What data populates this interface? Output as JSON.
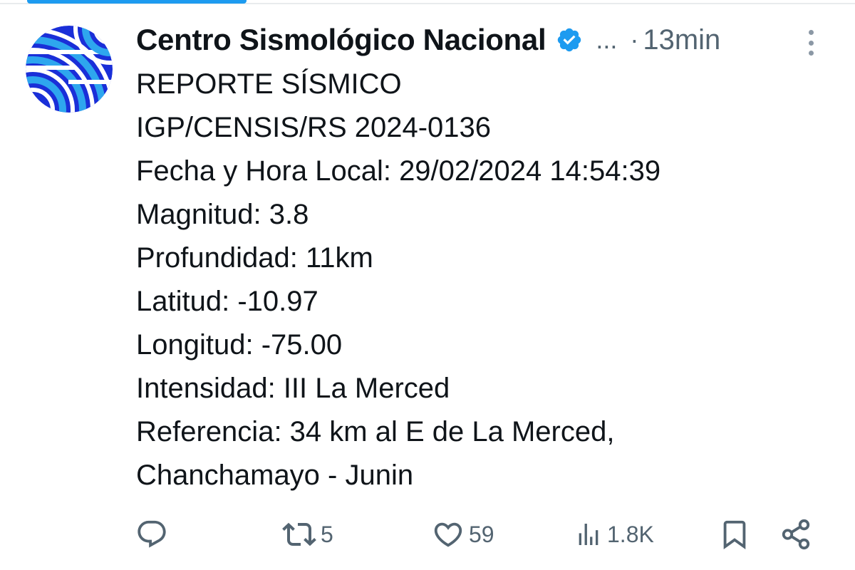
{
  "post": {
    "author": {
      "display_name": "Centro Sismológico Nacional",
      "handle_truncated": "...",
      "separator": "·",
      "time_ago": "13min",
      "verified": true,
      "avatar_icon": "seismic-waves-logo",
      "avatar_colors": [
        "#1a2fd8",
        "#2ea6ee",
        "#ffffff"
      ]
    },
    "lines": [
      "REPORTE SÍSMICO",
      "IGP/CENSIS/RS 2024-0136",
      "Fecha y Hora Local: 29/02/2024 14:54:39",
      "Magnitud: 3.8",
      "Profundidad: 11km",
      "Latitud: -10.97",
      "Longitud: -75.00",
      "Intensidad: III La Merced",
      "Referencia: 34 km al E de La Merced,",
      "Chanchamayo - Junin"
    ],
    "actions": {
      "reply": {
        "icon": "reply-icon",
        "count": ""
      },
      "repost": {
        "icon": "repost-icon",
        "count": "5"
      },
      "like": {
        "icon": "heart-icon",
        "count": "59"
      },
      "views": {
        "icon": "views-icon",
        "count": "1.8K"
      },
      "bookmark": {
        "icon": "bookmark-icon"
      },
      "share": {
        "icon": "share-icon"
      }
    }
  },
  "colors": {
    "text": "#0f1419",
    "muted": "#536471",
    "verified": "#1d9bf0",
    "accent": "#1d9bf0"
  }
}
